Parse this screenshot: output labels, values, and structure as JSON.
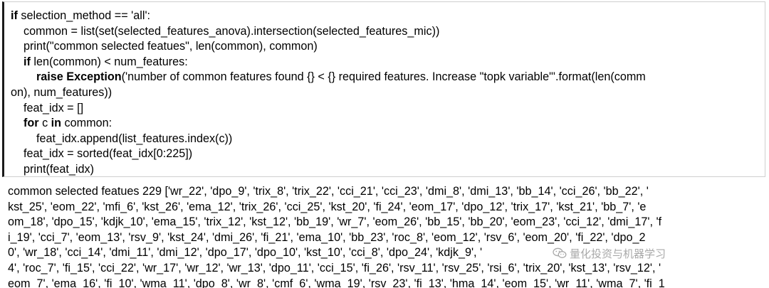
{
  "code_cell": {
    "lines": [
      {
        "parts": [
          {
            "kw": "if"
          },
          {
            "t": " selection_method == 'all':"
          }
        ]
      },
      {
        "parts": [
          {
            "t": "    common = list(set(selected_features_anova).intersection(selected_features_mic))"
          }
        ]
      },
      {
        "parts": [
          {
            "t": "    print(\"common selected featues\", len(common), common)"
          }
        ]
      },
      {
        "parts": [
          {
            "t": "    "
          },
          {
            "kw": "if"
          },
          {
            "t": " len(common) < num_features:"
          }
        ]
      },
      {
        "parts": [
          {
            "t": "        "
          },
          {
            "kw": "raise Exception"
          },
          {
            "t": "('number of common features found {} < {} required features. Increase \"topk variable\"'.format(len(comm"
          }
        ]
      },
      {
        "parts": [
          {
            "t": "on), num_features))"
          }
        ]
      },
      {
        "parts": [
          {
            "t": "    feat_idx = []"
          }
        ]
      },
      {
        "parts": [
          {
            "t": "    "
          },
          {
            "kw": "for"
          },
          {
            "t": " c "
          },
          {
            "kw": "in"
          },
          {
            "t": " common:"
          }
        ]
      },
      {
        "parts": [
          {
            "t": "        feat_idx.append(list_features.index(c))"
          }
        ]
      },
      {
        "parts": [
          {
            "t": "    feat_idx = sorted(feat_idx[0:225])"
          }
        ]
      },
      {
        "parts": [
          {
            "t": "    print(feat_idx)"
          }
        ]
      }
    ]
  },
  "output": {
    "lines": [
      "common selected featues 229 ['wr_22', 'dpo_9', 'trix_8', 'trix_22', 'cci_21', 'cci_23', 'dmi_8', 'dmi_13', 'bb_14', 'cci_26', 'bb_22', '",
      "kst_25', 'eom_22', 'mfi_6', 'kst_26', 'ema_12', 'trix_26', 'cci_25', 'kst_20', 'fi_24', 'eom_17', 'dpo_12', 'trix_17', 'kst_21', 'bb_7', 'e",
      "om_18', 'dpo_15', 'kdjk_10', 'ema_15', 'trix_12', 'kst_12', 'bb_19', 'wr_7', 'eom_26', 'bb_15', 'bb_20', 'eom_23', 'cci_12', 'dmi_17', 'f",
      "i_19', 'cci_7', 'eom_13', 'rsv_9', 'kst_24', 'dmi_26', 'fi_21', 'ema_10', 'bb_23', 'roc_8', 'eom_12', 'rsv_6', 'eom_20', 'fi_22', 'dpo_2",
      "0', 'wr_18', 'cci_14', 'dmi_11', 'dmi_12', 'dpo_17', 'dpo_10', 'kst_10', 'cci_8', 'dpo_24', 'kdjk_9', '",
      "4', 'roc_7', 'fi_15', 'cci_22', 'wr_17', 'wr_12', 'wr_13', 'dpo_11', 'cci_15', 'fi_26', 'rsv_11', 'rsv_25', 'rsi_6', 'trix_20', 'kst_13', 'rsv_12', '",
      "eom_7', 'ema_16', 'fi_10', 'wma_11', 'dpo_8', 'wr_8', 'cmf_6', 'wma_19', 'rsv_23', 'fi_13', 'hma_14', 'eom_15', 'wr_11', 'wma_7', 'fi_1"
    ]
  },
  "watermark": {
    "text": "量化投资与机器学习",
    "icon": "wechat-icon",
    "color": "#9a9a9a"
  }
}
